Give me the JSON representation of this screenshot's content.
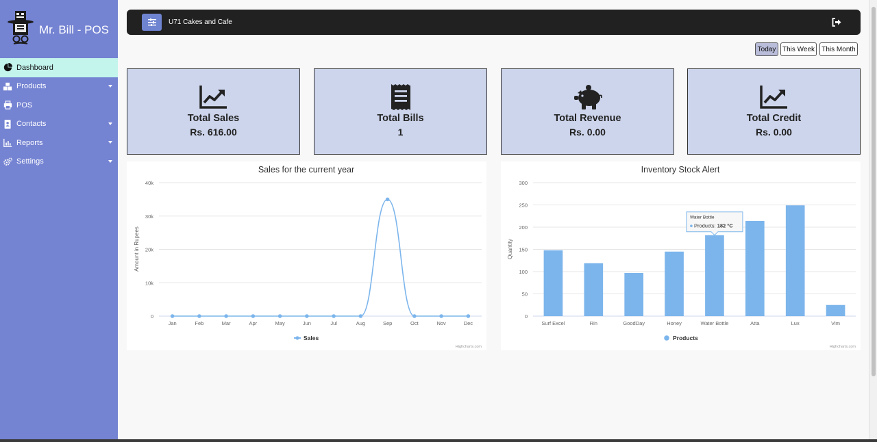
{
  "app": {
    "title": "Mr. Bill - POS"
  },
  "sidebar": {
    "items": [
      {
        "label": "Dashboard",
        "icon": "pie-chart-icon",
        "active": true,
        "has_submenu": false
      },
      {
        "label": "Products",
        "icon": "cubes-icon",
        "active": false,
        "has_submenu": true
      },
      {
        "label": "POS",
        "icon": "printer-icon",
        "active": false,
        "has_submenu": false
      },
      {
        "label": "Contacts",
        "icon": "address-book-icon",
        "active": false,
        "has_submenu": true
      },
      {
        "label": "Reports",
        "icon": "bar-chart-icon",
        "active": false,
        "has_submenu": true
      },
      {
        "label": "Settings",
        "icon": "cogs-icon",
        "active": false,
        "has_submenu": true
      }
    ]
  },
  "topbar": {
    "shop_name": "U71 Cakes and Cafe",
    "menu_icon": "sliders-icon",
    "logout_icon": "sign-out-icon"
  },
  "period": {
    "today": "Today",
    "week": "This Week",
    "month": "This Month",
    "selected": "Today"
  },
  "cards": [
    {
      "title": "Total Sales",
      "value": "Rs. 616.00",
      "icon": "line-chart-icon"
    },
    {
      "title": "Total Bills",
      "value": "1",
      "icon": "receipt-icon"
    },
    {
      "title": "Total Revenue",
      "value": "Rs. 0.00",
      "icon": "piggy-bank-icon"
    },
    {
      "title": "Total Credit",
      "value": "Rs. 0.00",
      "icon": "line-chart-icon"
    }
  ],
  "colors": {
    "sidebar": "#7483d2",
    "active_item": "#c3f5ec",
    "card_bg": "#cdd5ec",
    "series": "#7cb5ec",
    "topbar": "#212121"
  },
  "chart_data": [
    {
      "type": "line",
      "title": "Sales for the current year",
      "categories": [
        "Jan",
        "Feb",
        "Mar",
        "Apr",
        "May",
        "Jun",
        "Jul",
        "Aug",
        "Sep",
        "Oct",
        "Nov",
        "Dec"
      ],
      "series": [
        {
          "name": "Sales",
          "values": [
            0,
            0,
            0,
            0,
            0,
            0,
            0,
            0,
            35000,
            0,
            0,
            0
          ]
        }
      ],
      "ylabel": "Amount in Rupees",
      "yticks": [
        "0",
        "10k",
        "20k",
        "30k",
        "40k"
      ],
      "ylim": [
        0,
        40000
      ],
      "grid": true,
      "legend": "bottom-center",
      "credit": "Highcharts.com"
    },
    {
      "type": "bar",
      "title": "Inventory Stock Alert",
      "categories": [
        "Surf Excel",
        "Rin",
        "GoodDay",
        "Honey",
        "Water Bottle",
        "Atta",
        "Lux",
        "Vim"
      ],
      "series": [
        {
          "name": "Products",
          "values": [
            148,
            119,
            97,
            145,
            182,
            214,
            249,
            25
          ]
        }
      ],
      "ylabel": "Quantity",
      "yticks": [
        "0",
        "50",
        "100",
        "150",
        "200",
        "250",
        "300"
      ],
      "ylim": [
        0,
        300
      ],
      "grid": true,
      "legend": "bottom-center",
      "credit": "Highcharts.com",
      "tooltip": {
        "category": "Water Bottle",
        "series": "Products",
        "value": "182 °C"
      }
    }
  ]
}
